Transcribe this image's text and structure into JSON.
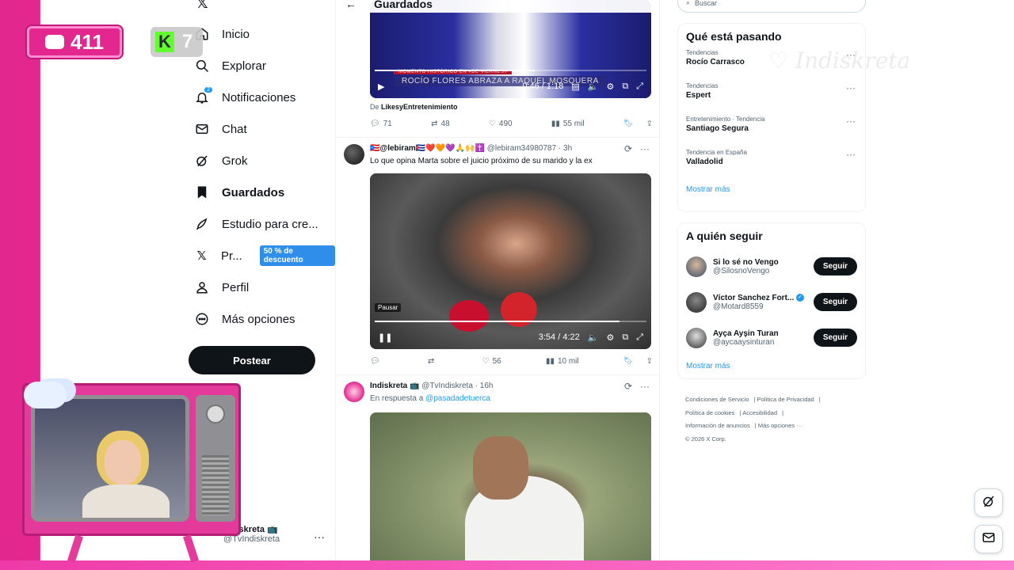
{
  "nav": {
    "items": [
      {
        "label": "Inicio",
        "icon": "home-icon"
      },
      {
        "label": "Explorar",
        "icon": "search-icon"
      },
      {
        "label": "Notificaciones",
        "icon": "bell-icon",
        "badge": "2"
      },
      {
        "label": "Chat",
        "icon": "mail-icon"
      },
      {
        "label": "Grok",
        "icon": "grok-icon"
      },
      {
        "label": "Guardados",
        "icon": "bookmark-icon",
        "active": true
      },
      {
        "label": "Estudio para cre...",
        "icon": "rocket-icon"
      },
      {
        "label": "Pr...",
        "icon": "x-logo-icon",
        "badge": "50 % de descuento"
      },
      {
        "label": "Perfil",
        "icon": "person-icon"
      },
      {
        "label": "Más opciones",
        "icon": "more-circle-icon"
      }
    ],
    "post_label": "Postear",
    "account": {
      "name": "Indiskreta 📺",
      "handle": "@TvIndiskreta"
    }
  },
  "feed": {
    "header_title": "Guardados",
    "tweet1": {
      "video_caption_small": "MOMENTO HISTÓRICO EN «DE VIERNES»",
      "video_caption": "ROCÍO FLORES ABRAZA A RAQUEL MOSQUERA",
      "time": "0:46 / 1:18",
      "progress": 0.59,
      "from_prefix": "De ",
      "from_name": "LikesyEntretenimiento",
      "replies": "71",
      "retweets": "48",
      "likes": "490",
      "views": "55 mil"
    },
    "tweet2": {
      "name": "🇵🇷@lebiram🇨🇺❤️🧡💜🙏🙌✝️",
      "handle": "@lebiram34980787",
      "time": "3h",
      "text": "Lo que opina Marta sobre el juicio próximo de su marido y la ex",
      "video_state": "Pausar",
      "video_time": "3:54 / 4:22",
      "progress": 0.9,
      "replies": "",
      "retweets": "",
      "likes": "56",
      "views": "10 mil"
    },
    "tweet3": {
      "name": "Indiskreta 📺",
      "handle": "@TvIndiskreta",
      "time": "16h",
      "reply_prefix": "En respuesta a ",
      "reply_to": "@pasadadetuerca"
    }
  },
  "right": {
    "search_placeholder": "Buscar",
    "trends_title": "Qué está pasando",
    "trends": [
      {
        "category": "Tendencias",
        "name": "Rocío Carrasco"
      },
      {
        "category": "Tendencias",
        "name": "Espert"
      },
      {
        "category": "Entretenimiento · Tendencia",
        "name": "Santiago Segura"
      },
      {
        "category": "Tendencia en España",
        "name": "Valladolid"
      }
    ],
    "show_more": "Mostrar más",
    "who_title": "A quién seguir",
    "who": [
      {
        "name": "Si lo sé no Vengo",
        "handle": "@SilosnoVengo",
        "verified": false
      },
      {
        "name": "Víctor Sanchez Fort...",
        "handle": "@Motard8559",
        "verified": true
      },
      {
        "name": "Ayça Ayşin Turan",
        "handle": "@aycaaysinturan",
        "verified": false
      }
    ],
    "follow_label": "Seguir",
    "footer": [
      "Condiciones de Servicio",
      "Política de Privacidad",
      "Política de cookies",
      "Accesibilidad",
      "Información de anuncios",
      "Más opciones ···",
      "© 2026 X Corp."
    ]
  },
  "overlay": {
    "chat_count": "411",
    "kick_count": "7",
    "kick_letter": "K"
  },
  "colors": {
    "accent": "#1d9bf0",
    "brand_pink": "#e2288f",
    "kick_green": "#53fc18"
  }
}
